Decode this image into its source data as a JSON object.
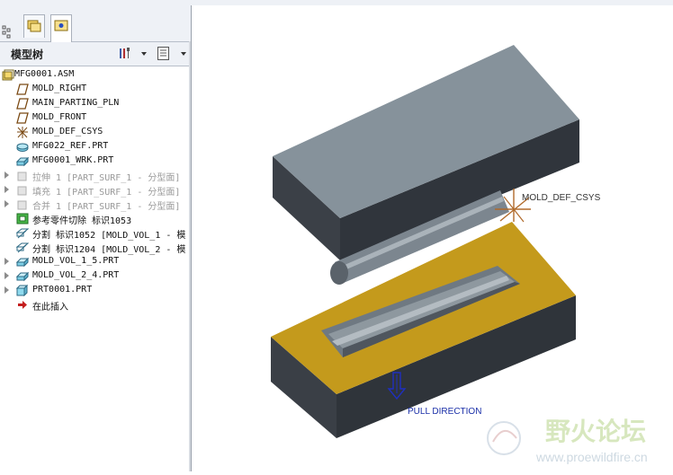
{
  "panel": {
    "title": "模型树"
  },
  "tree": [
    {
      "label": "MFG0001.ASM",
      "icon": "assembly-icon",
      "expander": false,
      "dim": false
    },
    {
      "label": "MOLD_RIGHT",
      "icon": "datum-plane-icon",
      "expander": false,
      "dim": false
    },
    {
      "label": "MAIN_PARTING_PLN",
      "icon": "datum-plane-icon",
      "expander": false,
      "dim": false
    },
    {
      "label": "MOLD_FRONT",
      "icon": "datum-plane-icon",
      "expander": false,
      "dim": false
    },
    {
      "label": "MOLD_DEF_CSYS",
      "icon": "csys-icon",
      "expander": false,
      "dim": false
    },
    {
      "label": "MFG022_REF.PRT",
      "icon": "ref-part-icon",
      "expander": false,
      "dim": false
    },
    {
      "label": "MFG0001_WRK.PRT",
      "icon": "workpiece-icon",
      "expander": false,
      "dim": false
    },
    {
      "label": "拉伸 1 [PART_SURF_1 - 分型面]",
      "icon": "extrude-icon",
      "expander": true,
      "dim": true
    },
    {
      "label": "填充 1 [PART_SURF_1 - 分型面]",
      "icon": "fill-icon",
      "expander": true,
      "dim": true
    },
    {
      "label": "合并 1 [PART_SURF_1 - 分型面]",
      "icon": "merge-icon",
      "expander": true,
      "dim": true
    },
    {
      "label": "参考零件切除 标识1053",
      "icon": "cutout-icon",
      "expander": false,
      "dim": false
    },
    {
      "label": "分割 标识1052 [MOLD_VOL_1 - 模",
      "icon": "split-icon",
      "expander": false,
      "dim": false
    },
    {
      "label": "分割 标识1204 [MOLD_VOL_2 - 模",
      "icon": "split-icon",
      "expander": false,
      "dim": false
    },
    {
      "label": "MOLD_VOL_1_5.PRT",
      "icon": "mold-volume-icon",
      "expander": true,
      "dim": false
    },
    {
      "label": "MOLD_VOL_2_4.PRT",
      "icon": "mold-volume-icon",
      "expander": true,
      "dim": false
    },
    {
      "label": "PRT0001.PRT",
      "icon": "part-icon",
      "expander": true,
      "dim": false
    },
    {
      "label": "在此插入",
      "icon": "insert-here-icon",
      "expander": false,
      "dim": false
    }
  ],
  "viewport": {
    "csys_label": "MOLD_DEF_CSYS",
    "pull_direction_label": "PULL DIRECTION",
    "watermark_cn": "野火论坛",
    "watermark_url": "www.proewildfire.cn",
    "colors": {
      "top_mold": "#85919b",
      "bottom_mold_top": "#c49a1c",
      "dark_side": "#3b4047",
      "csys": "#b06a2a",
      "pull_arrow": "#1f2fbf"
    }
  }
}
